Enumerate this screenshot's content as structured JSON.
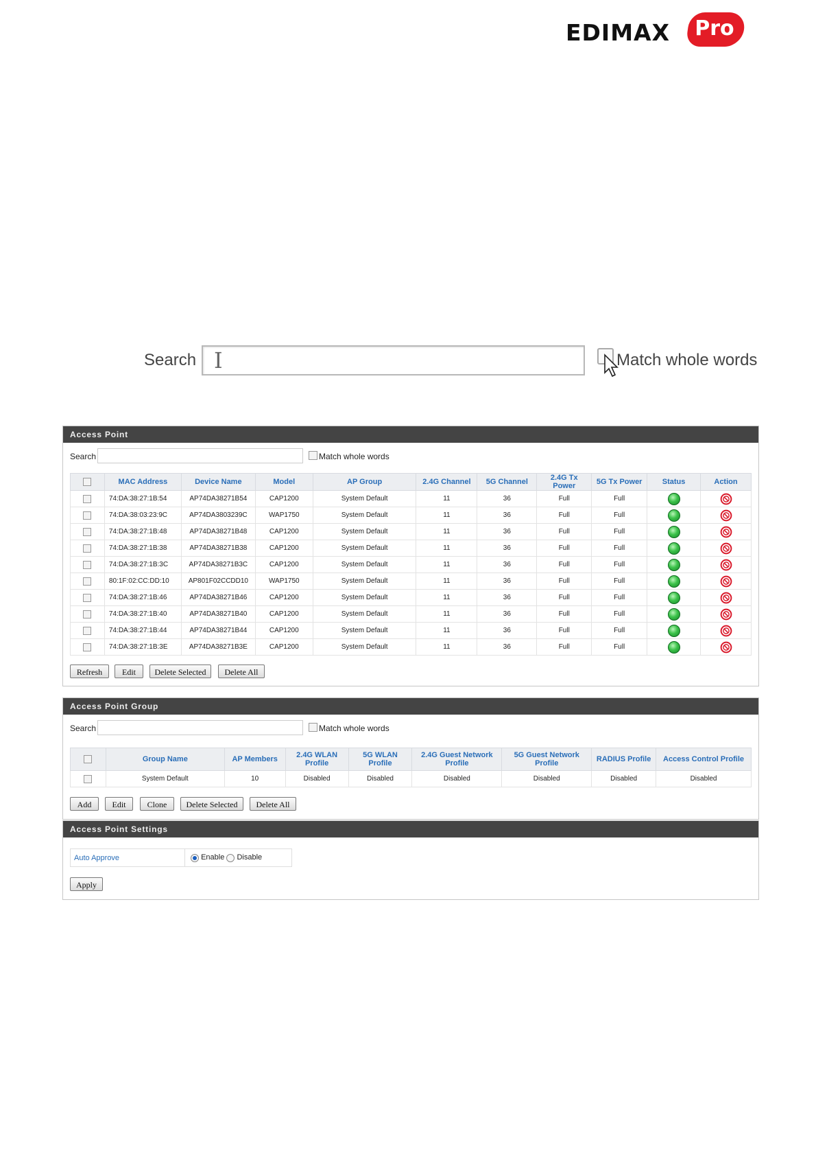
{
  "brand": {
    "name": "EDIMAX",
    "suffix": "Pro"
  },
  "zoomed_search": {
    "label": "Search",
    "match_label": "Match whole words"
  },
  "access_point": {
    "title": "Access Point",
    "search_label": "Search",
    "match_label": "Match whole words",
    "columns": [
      "MAC Address",
      "Device Name",
      "Model",
      "AP Group",
      "2.4G Channel",
      "5G Channel",
      "2.4G Tx Power",
      "5G Tx Power",
      "Status",
      "Action"
    ],
    "rows": [
      [
        "74:DA:38:27:1B:54",
        "AP74DA38271B54",
        "CAP1200",
        "System Default",
        "11",
        "36",
        "Full",
        "Full"
      ],
      [
        "74:DA:38:03:23:9C",
        "AP74DA3803239C",
        "WAP1750",
        "System Default",
        "11",
        "36",
        "Full",
        "Full"
      ],
      [
        "74:DA:38:27:1B:48",
        "AP74DA38271B48",
        "CAP1200",
        "System Default",
        "11",
        "36",
        "Full",
        "Full"
      ],
      [
        "74:DA:38:27:1B:38",
        "AP74DA38271B38",
        "CAP1200",
        "System Default",
        "11",
        "36",
        "Full",
        "Full"
      ],
      [
        "74:DA:38:27:1B:3C",
        "AP74DA38271B3C",
        "CAP1200",
        "System Default",
        "11",
        "36",
        "Full",
        "Full"
      ],
      [
        "80:1F:02:CC:DD:10",
        "AP801F02CCDD10",
        "WAP1750",
        "System Default",
        "11",
        "36",
        "Full",
        "Full"
      ],
      [
        "74:DA:38:27:1B:46",
        "AP74DA38271B46",
        "CAP1200",
        "System Default",
        "11",
        "36",
        "Full",
        "Full"
      ],
      [
        "74:DA:38:27:1B:40",
        "AP74DA38271B40",
        "CAP1200",
        "System Default",
        "11",
        "36",
        "Full",
        "Full"
      ],
      [
        "74:DA:38:27:1B:44",
        "AP74DA38271B44",
        "CAP1200",
        "System Default",
        "11",
        "36",
        "Full",
        "Full"
      ],
      [
        "74:DA:38:27:1B:3E",
        "AP74DA38271B3E",
        "CAP1200",
        "System Default",
        "11",
        "36",
        "Full",
        "Full"
      ]
    ],
    "buttons": [
      "Refresh",
      "Edit",
      "Delete Selected",
      "Delete All"
    ]
  },
  "access_point_group": {
    "title": "Access Point Group",
    "search_label": "Search",
    "match_label": "Match whole words",
    "columns": [
      "Group Name",
      "AP Members",
      "2.4G WLAN Profile",
      "5G WLAN Profile",
      "2.4G Guest Network Profile",
      "5G Guest Network Profile",
      "RADIUS Profile",
      "Access Control Profile"
    ],
    "rows": [
      [
        "System Default",
        "10",
        "Disabled",
        "Disabled",
        "Disabled",
        "Disabled",
        "Disabled",
        "Disabled"
      ]
    ],
    "buttons": [
      "Add",
      "Edit",
      "Clone",
      "Delete Selected",
      "Delete All"
    ]
  },
  "access_point_settings": {
    "title": "Access Point Settings",
    "auto_approve_label": "Auto Approve",
    "enable_label": "Enable",
    "disable_label": "Disable",
    "selected": "Enable",
    "apply_label": "Apply"
  },
  "colors": {
    "header_bg": "#444444",
    "column_header_text": "#2a6eb8",
    "status_ok": "#3cc24a",
    "action_stop": "#d9192a",
    "brand_red": "#e31c26"
  },
  "icons": {
    "status": "status-online-icon",
    "action": "no-entry-icon",
    "cursor_text": "text-cursor-icon",
    "cursor_pointer": "mouse-pointer-icon"
  }
}
